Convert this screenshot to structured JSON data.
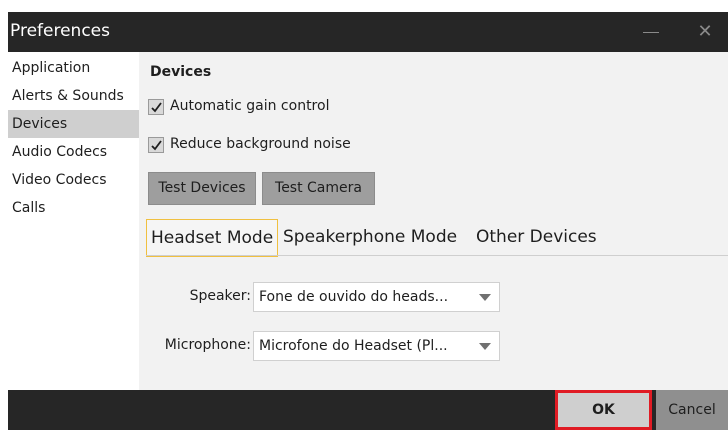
{
  "window": {
    "title": "Preferences",
    "minimize_glyph": "—",
    "close_glyph": "✕"
  },
  "sidebar": {
    "items": [
      {
        "label": "Application"
      },
      {
        "label": "Alerts & Sounds"
      },
      {
        "label": "Devices",
        "active": true
      },
      {
        "label": "Audio Codecs"
      },
      {
        "label": "Video Codecs"
      },
      {
        "label": "Calls"
      }
    ]
  },
  "devices": {
    "title": "Devices",
    "automatic_gain": {
      "label": "Automatic gain control",
      "checked": true
    },
    "reduce_noise": {
      "label": "Reduce background noise",
      "checked": true
    },
    "test_devices_label": "Test Devices",
    "test_camera_label": "Test Camera",
    "tabs": [
      {
        "label": "Headset Mode",
        "active": true
      },
      {
        "label": "Speakerphone Mode"
      },
      {
        "label": "Other Devices"
      }
    ],
    "speaker": {
      "label": "Speaker:",
      "value": "Fone de ouvido do heads..."
    },
    "microphone": {
      "label": "Microphone:",
      "value": "Microfone do Headset (Pl..."
    }
  },
  "footer": {
    "ok_label": "OK",
    "cancel_label": "Cancel"
  },
  "colors": {
    "titlebar": "#262626",
    "ok_highlight": "#e01b24",
    "active_tab_border": "#f0c040"
  }
}
